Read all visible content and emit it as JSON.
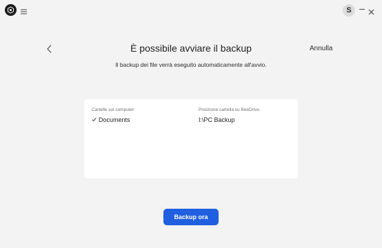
{
  "titlebar": {
    "avatar_initial": "S"
  },
  "header": {
    "title": "È possibile avviare il backup",
    "subtitle": "Il backup dei file verrà eseguito automaticamente all'avvio.",
    "cancel_label": "Annulla"
  },
  "card": {
    "left_label": "Cartelle sul computer",
    "left_value": "Documents",
    "right_label": "Posizione cartella su BeeDrive",
    "right_value": "I:\\PC Backup"
  },
  "actions": {
    "primary_label": "Backup ora"
  },
  "colors": {
    "primary": "#1f5fe0",
    "background": "#f3f3f3",
    "card": "#ffffff"
  }
}
